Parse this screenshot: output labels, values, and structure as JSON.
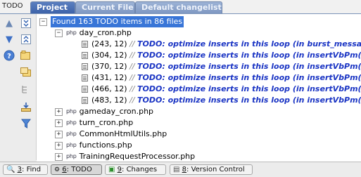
{
  "panel": {
    "title": "TODO"
  },
  "tabs": [
    "Project",
    "Current File",
    "Default changelist"
  ],
  "tree": {
    "root_label": "Found 163 TODO items in 86 files",
    "files": [
      {
        "name": "day_cron.php",
        "expanded": true,
        "items": [
          {
            "loc": "(243, 12)",
            "comment": "//",
            "text": "TODO: optimize inserts in this loop (in burst_message())"
          },
          {
            "loc": "(304, 12)",
            "comment": "//",
            "text": "TODO: optimize inserts in this loop (in insertVbPm())"
          },
          {
            "loc": "(370, 12)",
            "comment": "//",
            "text": "TODO: optimize inserts in this loop (in insertVbPm())"
          },
          {
            "loc": "(431, 12)",
            "comment": "//",
            "text": "TODO: optimize inserts in this loop (in insertVbPm())"
          },
          {
            "loc": "(466, 12)",
            "comment": "//",
            "text": "TODO: optimize inserts in this loop (in insertVbPm())"
          },
          {
            "loc": "(483, 12)",
            "comment": "//",
            "text": "TODO: optimize inserts in this loop (in insertVbPm())"
          }
        ]
      },
      {
        "name": "gameday_cron.php",
        "expanded": false
      },
      {
        "name": "turn_cron.php",
        "expanded": false
      },
      {
        "name": "CommonHtmlUtils.php",
        "expanded": false
      },
      {
        "name": "functions.php",
        "expanded": false
      },
      {
        "name": "TrainingRequestProcessor.php",
        "expanded": false
      }
    ]
  },
  "file_type_label": "php",
  "statusbar": [
    {
      "key": "3",
      "label": ": Find",
      "icon": "search-icon"
    },
    {
      "key": "6",
      "label": ": TODO",
      "icon": "todo-icon"
    },
    {
      "key": "9",
      "label": ": Changes",
      "icon": "changes-icon"
    },
    {
      "key": "8",
      "label": ": Version Control",
      "icon": "version-control-icon"
    }
  ],
  "colors": {
    "tab_active": "#4a6fb3",
    "tab_inactive": "#8fa8d0",
    "todo_text": "#1b35c4",
    "root_highlight": "#3875d7"
  }
}
